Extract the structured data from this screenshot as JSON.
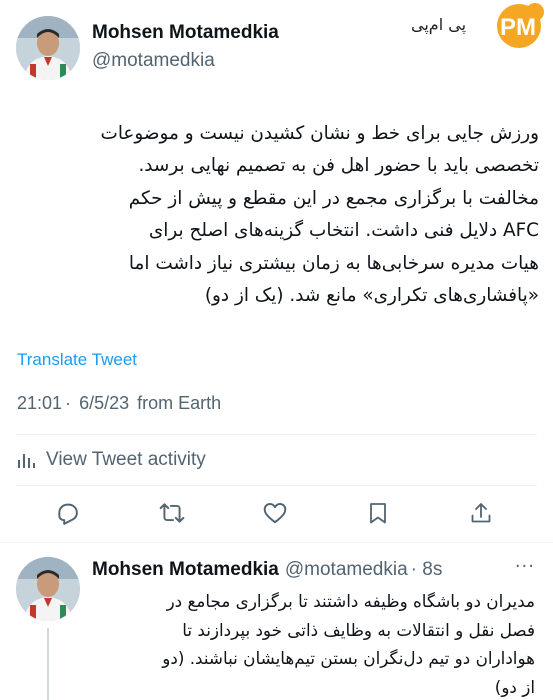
{
  "watermark": {
    "text": "پی ام‌پی",
    "logo_text": "PM",
    "color": "#f5a623"
  },
  "tweet": {
    "author_name": "Mohsen Motamedkia",
    "author_handle": "@motamedkia",
    "lines": [
      "ورزش جایی برای خط و نشان کشیدن نیست و موضوعات",
      "تخصصی باید با حضور اهل فن به تصمیم نهایی برسد.",
      "مخالفت با برگزاری مجمع در این مقطع و پیش از حکم",
      "AFC دلایل فنی داشت. انتخاب گزینه‌های اصلح برای",
      "هیات مدیره سرخابی‌ها به زمان بیشتری نیاز داشت اما",
      "«پافشاری‌های تکراری» مانع شد. (یک از دو)"
    ],
    "translate_label": "Translate Tweet",
    "time": "21:01",
    "date": "6/5/23",
    "source": "from Earth",
    "activity_label": "View Tweet activity"
  },
  "actions": [
    {
      "name": "reply",
      "icon": "reply-icon"
    },
    {
      "name": "retweet",
      "icon": "retweet-icon"
    },
    {
      "name": "like",
      "icon": "heart-icon"
    },
    {
      "name": "bookmark",
      "icon": "bookmark-icon"
    },
    {
      "name": "share",
      "icon": "share-icon"
    }
  ],
  "reply": {
    "author_name": "Mohsen Motamedkia",
    "author_handle": "@motamedkia",
    "age": "· 8s",
    "more_label": "···",
    "lines": [
      "مدیران دو باشگاه وظیفه داشتند تا برگزاری مجامع در",
      "فصل نقل و انتقالات به وظایف ذاتی خود بپردازند تا",
      "هواداران دو تیم دل‌نگران بستن تیم‌هایشان نباشند. (دو",
      "از دو)"
    ]
  },
  "colors": {
    "accent": "#1d9bf0",
    "text": "#0f1419",
    "secondary": "#536471",
    "divider": "#eff3f4"
  }
}
